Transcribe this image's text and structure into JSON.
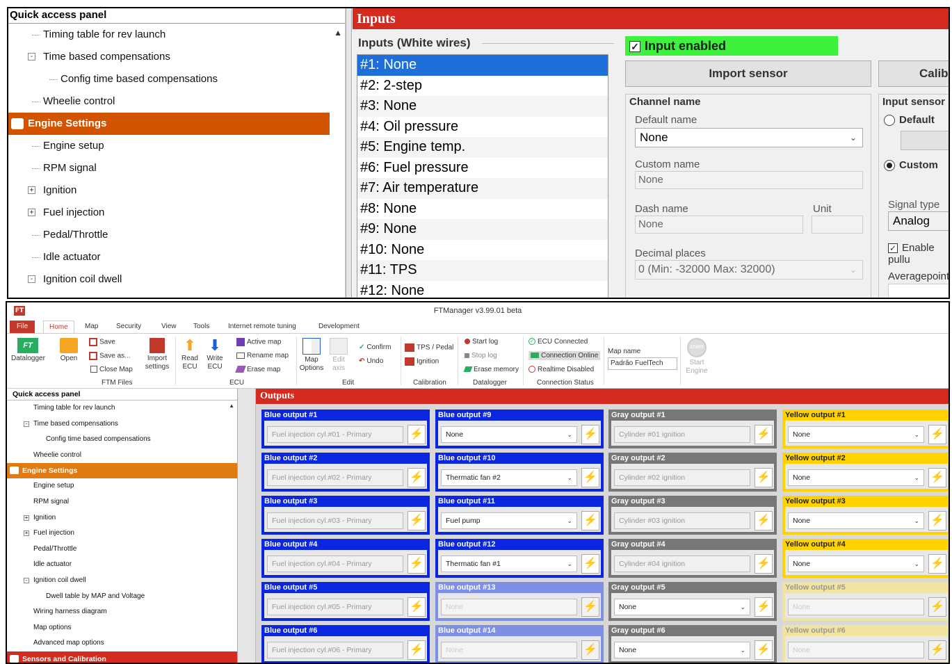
{
  "top": {
    "quick_access_title": "Quick access panel",
    "tree": [
      {
        "label": "Timing table for rev launch",
        "level": 1
      },
      {
        "label": "Time based compensations",
        "level": 1,
        "expander": "-"
      },
      {
        "label": "Config time based compensations",
        "level": 2
      },
      {
        "label": "Wheelie control",
        "level": 1
      }
    ],
    "engine_settings": "Engine Settings",
    "tree2": [
      {
        "label": "Engine setup",
        "expander": ""
      },
      {
        "label": "RPM signal",
        "expander": ""
      },
      {
        "label": "Ignition",
        "expander": "+"
      },
      {
        "label": "Fuel injection",
        "expander": "+"
      },
      {
        "label": "Pedal/Throttle",
        "expander": ""
      },
      {
        "label": "Idle actuator",
        "expander": ""
      },
      {
        "label": "Ignition coil dwell",
        "expander": "-"
      }
    ],
    "inputs_title": "Inputs",
    "inputs_group": "Inputs (White wires)",
    "inputs": [
      "#1: None",
      "#2: 2-step",
      "#3: None",
      "#4: Oil pressure",
      "#5: Engine temp.",
      "#6: Fuel pressure",
      "#7: Air temperature",
      "#8: None",
      "#9: None",
      "#10: None",
      "#11: TPS",
      "#12: None"
    ],
    "input_enabled": "Input enabled",
    "import_sensor": "Import sensor",
    "calibrate": "Calibra",
    "channel_name": "Channel name",
    "default_name_label": "Default name",
    "default_name_value": "None",
    "custom_name_label": "Custom name",
    "custom_name_value": "None",
    "dash_name_label": "Dash name",
    "dash_name_value": "None",
    "unit_label": "Unit",
    "decimal_label": "Decimal places",
    "decimal_value": "0 (Min: -32000  Max: 32000)",
    "input_sensor": "Input sensor",
    "radio_default": "Default",
    "radio_custom": "Custom",
    "signal_type_label": "Signal type",
    "signal_type_value": "Analog",
    "enable_pull": "Enable pullu",
    "average_points": "Averagepoints"
  },
  "app": {
    "window_title": "FTManager v3.99.01 beta",
    "logo": "FT",
    "menu": [
      "File",
      "Home",
      "Map",
      "Security",
      "View",
      "Tools",
      "Internet remote tuning",
      "Development"
    ],
    "ribbon": {
      "datalogger": "Datalogger",
      "open": "Open",
      "save": "Save",
      "save_as": "Save as...",
      "close_map": "Close Map",
      "import_settings": "Import settings",
      "ftm_files": "FTM Files",
      "read_ecu": "Read ECU",
      "write_ecu": "Write ECU",
      "active_map": "Active map",
      "rename_map": "Rename map",
      "erase_map": "Erase map",
      "ecu_group": "ECU",
      "map_options": "Map Options",
      "edit_axis": "Edit axis",
      "confirm": "Confirm",
      "undo": "Undo",
      "edit_group": "Edit",
      "tps_pedal": "TPS / Pedal",
      "ignition": "Ignition",
      "calibration_group": "Calibration",
      "start_log": "Start log",
      "stop_log": "Stop log",
      "erase_memory": "Erase memory",
      "datalogger_group": "Datalogger",
      "ecu_connected": "ECU Connected",
      "connection_online": "Connection Online",
      "realtime_disabled": "Realtime Disabled",
      "connection_group": "Connection Status",
      "map_name_label": "Map name",
      "map_name_value": "Padrão FuelTech",
      "start_engine": "Start Engine",
      "start_badge": "START"
    },
    "quick_access_title": "Quick access panel",
    "tree": [
      {
        "label": "Timing table for rev launch",
        "indent": 1
      },
      {
        "label": "Time based compensations",
        "indent": 1,
        "expander": "-"
      },
      {
        "label": "Config time based compensations",
        "indent": 2
      },
      {
        "label": "Wheelie control",
        "indent": 1
      }
    ],
    "engine_settings": "Engine Settings",
    "tree2": [
      {
        "label": "Engine setup",
        "indent": 1
      },
      {
        "label": "RPM signal",
        "indent": 1
      },
      {
        "label": "Ignition",
        "indent": 1,
        "expander": "+"
      },
      {
        "label": "Fuel injection",
        "indent": 1,
        "expander": "+"
      },
      {
        "label": "Pedal/Throttle",
        "indent": 1
      },
      {
        "label": "Idle actuator",
        "indent": 1
      },
      {
        "label": "Ignition coil dwell",
        "indent": 1,
        "expander": "-"
      },
      {
        "label": "Dwell table by MAP and Voltage",
        "indent": 2
      },
      {
        "label": "Wiring harness diagram",
        "indent": 1
      },
      {
        "label": "Map options",
        "indent": 1
      },
      {
        "label": "Advanced map options",
        "indent": 1
      }
    ],
    "sensors_section": "Sensors and Calibration",
    "outputs_title": "Outputs",
    "outputs": {
      "blue": [
        {
          "title": "Blue output #1",
          "value": "Fuel injection cyl.#01 - Primary"
        },
        {
          "title": "Blue output #2",
          "value": "Fuel injection cyl.#02 - Primary"
        },
        {
          "title": "Blue output #3",
          "value": "Fuel injection cyl.#03 - Primary"
        },
        {
          "title": "Blue output #4",
          "value": "Fuel injection cyl.#04 - Primary"
        },
        {
          "title": "Blue output #5",
          "value": "Fuel injection cyl.#05 - Primary"
        },
        {
          "title": "Blue output #6",
          "value": "Fuel injection cyl.#06 - Primary"
        }
      ],
      "blue2": [
        {
          "title": "Blue output #9",
          "value": "None"
        },
        {
          "title": "Blue output #10",
          "value": "Thermatic fan #2"
        },
        {
          "title": "Blue output #11",
          "value": "Fuel pump"
        },
        {
          "title": "Blue output #12",
          "value": "Thermatic fan #1"
        },
        {
          "title": "Blue output #13",
          "value": "None"
        },
        {
          "title": "Blue output #14",
          "value": "None"
        }
      ],
      "gray": [
        {
          "title": "Gray output #1",
          "value": "Cylinder #01 ignition"
        },
        {
          "title": "Gray output #2",
          "value": "Cylinder #02 ignition"
        },
        {
          "title": "Gray output #3",
          "value": "Cylinder #03 ignition"
        },
        {
          "title": "Gray output #4",
          "value": "Cylinder #04 ignition"
        },
        {
          "title": "Gray output #5",
          "value": "None"
        },
        {
          "title": "Gray output #6",
          "value": "None"
        }
      ],
      "yellow": [
        {
          "title": "Yellow output #1",
          "value": "None"
        },
        {
          "title": "Yellow output #2",
          "value": "None"
        },
        {
          "title": "Yellow output #3",
          "value": "None"
        },
        {
          "title": "Yellow output #4",
          "value": "None"
        },
        {
          "title": "Yellow output #5",
          "value": "None"
        },
        {
          "title": "Yellow output #6",
          "value": "None"
        }
      ]
    },
    "colors": {
      "accent_red": "#d42a1f",
      "orange": "#d35400",
      "blue": "#0a26e0",
      "gray": "#777777",
      "yellow": "#ffd200",
      "green": "#3df23d"
    }
  }
}
